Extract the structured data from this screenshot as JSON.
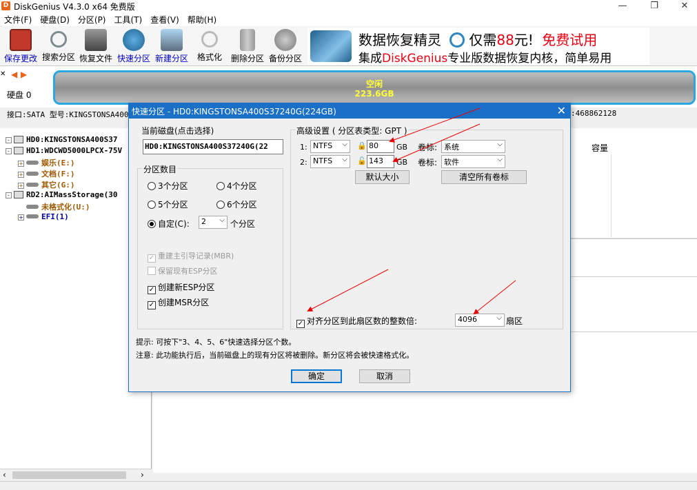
{
  "window": {
    "title": "DiskGenius V4.3.0 x64 免费版",
    "logo_letter": "D"
  },
  "menu": [
    "文件(F)",
    "硬盘(D)",
    "分区(P)",
    "工具(T)",
    "查看(V)",
    "帮助(H)"
  ],
  "toolbar": [
    {
      "label": "保存更改",
      "icon": "save-icon",
      "color": "#c0392b"
    },
    {
      "label": "搜索分区",
      "icon": "magnifier-icon",
      "color": "#7f8c8d"
    },
    {
      "label": "恢复文件",
      "icon": "recover-icon",
      "color": "#555555"
    },
    {
      "label": "快速分区",
      "icon": "quick-partition-icon",
      "color": "#2471a3"
    },
    {
      "label": "新建分区",
      "icon": "new-partition-icon",
      "color": "#5d6d7e"
    },
    {
      "label": "格式化",
      "icon": "format-icon",
      "color": "#999999"
    },
    {
      "label": "删除分区",
      "icon": "delete-icon",
      "color": "#777777"
    },
    {
      "label": "备份分区",
      "icon": "backup-icon",
      "color": "#888888"
    }
  ],
  "banner": {
    "line1a": "数据恢复精灵",
    "line1b": "仅需",
    "price": "88",
    "line1c": "元!",
    "line1d": "免费试用",
    "line2a": "集成",
    "brand": "DiskGenius",
    "line2b": "专业版数据恢复内核，简单易用"
  },
  "disk": {
    "label": "硬盘 0",
    "free_label": "空闲",
    "free_size": "223.6GB"
  },
  "infostrip": {
    "left": "接口:SATA  型号:KINGSTONSA400",
    "right": ":468862128"
  },
  "tree": [
    {
      "text": "HD0:KINGSTONSA400S37",
      "indent": 0,
      "kind": "disk",
      "exp": "-",
      "cls": ""
    },
    {
      "text": "HD1:WDCWD5000LPCX-75V",
      "indent": 0,
      "kind": "disk",
      "exp": "-",
      "cls": ""
    },
    {
      "text": "娱乐(E:)",
      "indent": 1,
      "kind": "part",
      "exp": "+",
      "cls": "orange"
    },
    {
      "text": "文档(F:)",
      "indent": 1,
      "kind": "part",
      "exp": "+",
      "cls": "orange"
    },
    {
      "text": "其它(G:)",
      "indent": 1,
      "kind": "part",
      "exp": "+",
      "cls": "orange"
    },
    {
      "text": "RD2:AIMassStorage(30",
      "indent": 0,
      "kind": "disk",
      "exp": "-",
      "cls": ""
    },
    {
      "text": "未格式化(U:)",
      "indent": 1,
      "kind": "part",
      "exp": "",
      "cls": "orange"
    },
    {
      "text": "EFI(1)",
      "indent": 1,
      "kind": "part",
      "exp": "+",
      "cls": "blue"
    }
  ],
  "right_panel": {
    "capacity_header": "容量"
  },
  "dialog": {
    "title": "快速分区 - HD0:KINGSTONSA400S37240G(224GB)",
    "current_disk_label": "当前磁盘(点击选择)",
    "current_disk_value": "HD0:KINGSTONSA400S37240G(22",
    "count_group": "分区数目",
    "opt3": "3个分区",
    "opt4": "4个分区",
    "opt5": "5个分区",
    "opt6": "6个分区",
    "custom": "自定(C):",
    "custom_value": "2",
    "custom_suffix": "个分区",
    "mbr": "重建主引导记录(MBR)",
    "keep_esp": "保留现有ESP分区",
    "new_esp": "创建新ESP分区",
    "msr": "创建MSR分区",
    "adv_group": "高级设置 ( 分区表类型: GPT )",
    "rows": [
      {
        "num": "1:",
        "fs": "NTFS",
        "size": "80",
        "unit": "GB",
        "vol_label": "卷标:",
        "vol": "系统"
      },
      {
        "num": "2:",
        "fs": "NTFS",
        "size": "143",
        "unit": "GB",
        "vol_label": "卷标:",
        "vol": "软件"
      }
    ],
    "default_size_btn": "默认大小",
    "clear_labels_btn": "清空所有卷标",
    "align_label": "对齐分区到此扇区数的整数倍:",
    "align_value": "4096",
    "align_unit": "扇区",
    "tip1": "提示: 可按下\"3、4、5、6\"快速选择分区个数。",
    "tip2": "注意: 此功能执行后，当前磁盘上的现有分区将被删除。新分区将会被快速格式化。",
    "ok": "确定",
    "cancel": "取消"
  }
}
